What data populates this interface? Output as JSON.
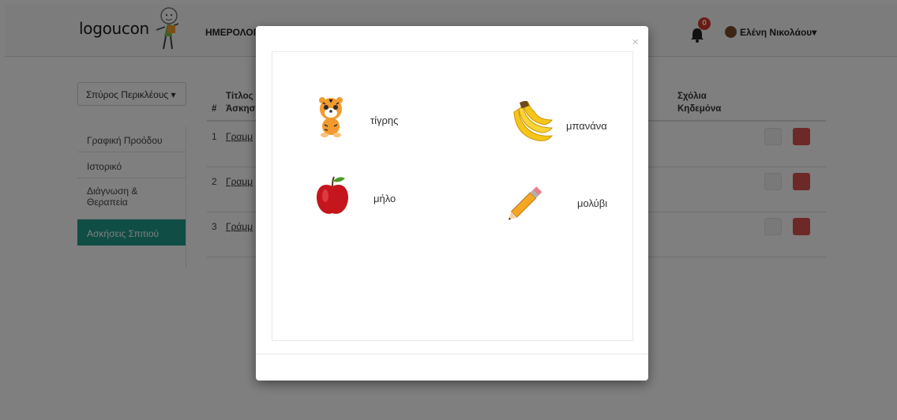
{
  "header": {
    "logo_text": "logoucon",
    "nav_link": "ΗΜΕΡΟΛΟΓ",
    "notification_count": "0",
    "user_name": "Ελένη Νικολάου",
    "user_caret": "▾"
  },
  "sidebar": {
    "dropdown_label": "Σπύρος Περικλέους ▾",
    "items": [
      {
        "label": "Γραφική Προόδου"
      },
      {
        "label": "Ιστορικό"
      },
      {
        "label": "Διάγνωση & Θεραπεία"
      },
      {
        "label": "Ασκήσεις Σπιτιού"
      }
    ]
  },
  "table": {
    "headers": {
      "num": "#",
      "title_1": "Τίτλος",
      "title_2": "Άσκησ",
      "comments_1": "Σχόλια",
      "comments_2": "Κηδεμόνα"
    },
    "rows": [
      {
        "num": "1",
        "title": "Γραμμ"
      },
      {
        "num": "2",
        "title": "Γραμμ"
      },
      {
        "num": "3",
        "title": "Γράμμ"
      }
    ]
  },
  "modal": {
    "close_label": "×",
    "cards": [
      {
        "label": "τίγρης",
        "icon": "tiger-icon"
      },
      {
        "label": "μπανάνα",
        "icon": "banana-icon"
      },
      {
        "label": "μήλο",
        "icon": "apple-icon"
      },
      {
        "label": "μολύβι",
        "icon": "pencil-icon"
      }
    ]
  },
  "colors": {
    "accent": "#1e9b8b",
    "danger": "#d9534f",
    "badge": "#d9342b"
  }
}
